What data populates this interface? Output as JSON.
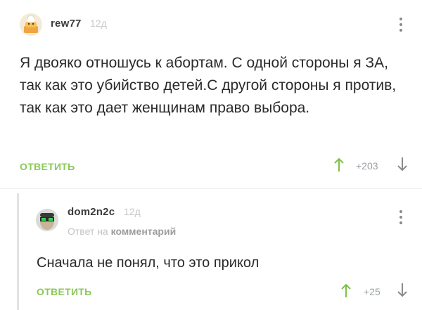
{
  "colors": {
    "accent_green": "#8ac858",
    "arrow_up": "#7cc04a",
    "arrow_down": "#8a8a8a",
    "muted_text": "#c8c8c8"
  },
  "comment": {
    "avatar_icon": "chef-cat-avatar",
    "username": "rew77",
    "time": "12д",
    "text": "Я двояко отношусь к абортам. С одной стороны я ЗА, так как это убийство детей.С другой стороны я против, так как это дает женщинам право выбора.",
    "reply_label": "ОТВЕТИТЬ",
    "score": "+203"
  },
  "reply": {
    "avatar_icon": "masked-face-avatar",
    "username": "dom2n2c",
    "time": "12д",
    "reply_to_prefix": "Ответ на",
    "reply_to_link": "комментарий",
    "text": "Сначала не понял, что это прикол",
    "reply_label": "ОТВЕТИТЬ",
    "score": "+25"
  }
}
